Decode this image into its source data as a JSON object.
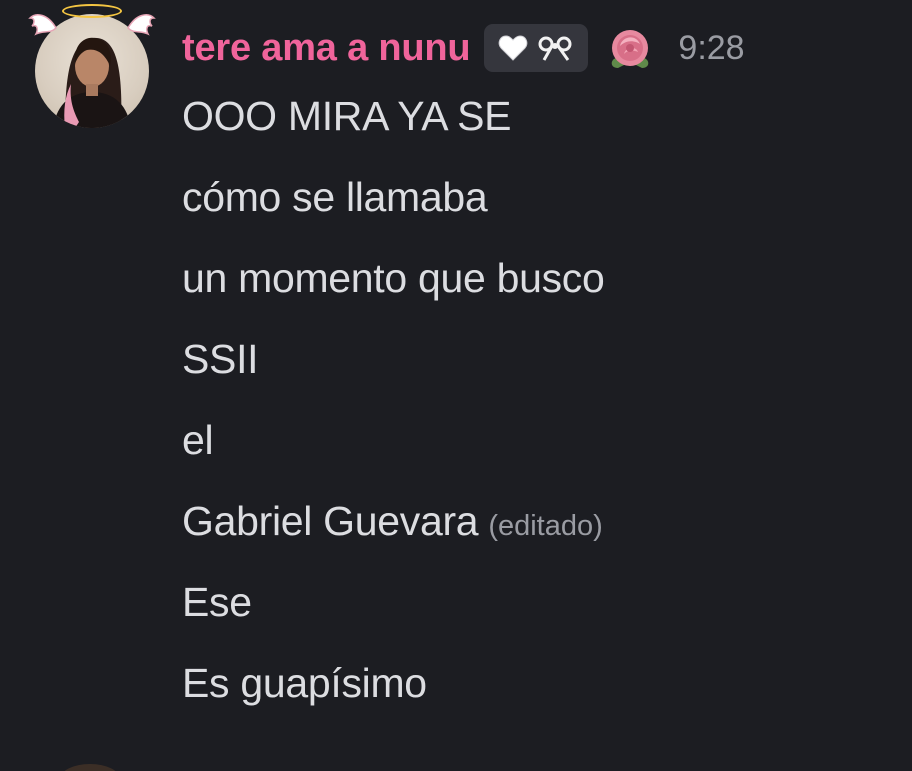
{
  "message": {
    "username": "tere ama a nunu",
    "timestamp": "9:28",
    "edited_label": "(editado)",
    "icons": [
      "white-heart-icon",
      "bow-icon",
      "rose-icon",
      "halo-icon",
      "wing-icon"
    ],
    "lines": [
      "OOO MIRA YA SE",
      "cómo se llamaba",
      "un momento que busco",
      "SSII",
      "el",
      "Gabriel Guevara",
      "Ese",
      "Es guapísimo"
    ]
  },
  "colors": {
    "background": "#1c1d22",
    "username": "#f0649b",
    "text": "#dcdde1",
    "muted": "#9a9ca3",
    "badge": "#35363d"
  }
}
